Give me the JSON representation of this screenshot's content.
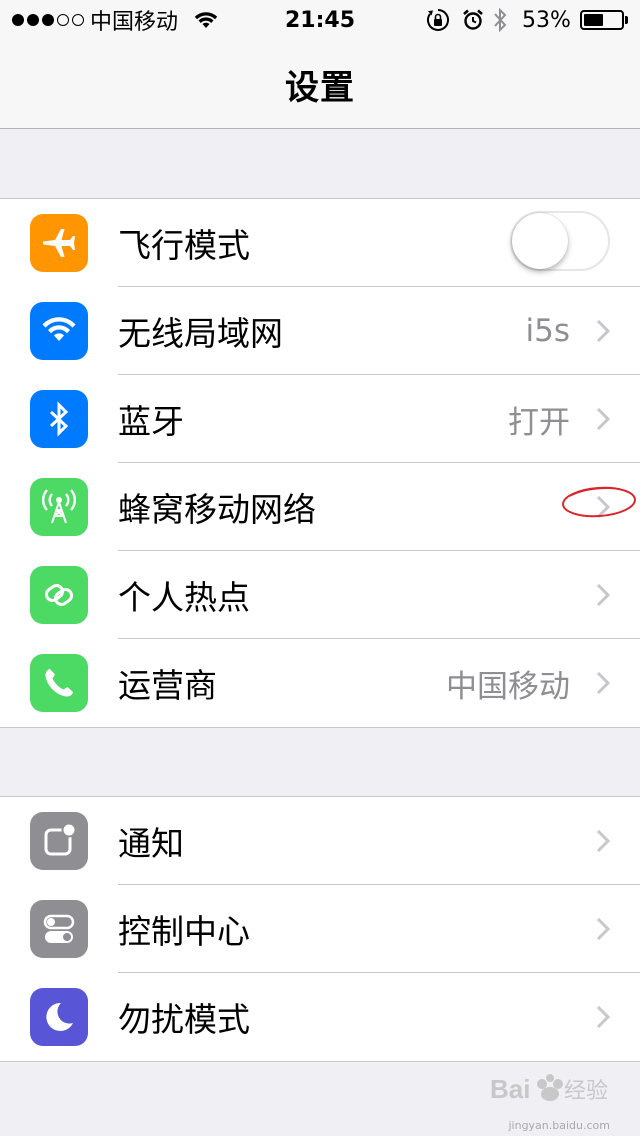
{
  "status_bar": {
    "carrier": "中国移动",
    "time": "21:45",
    "battery_percent": "53%",
    "battery_level": 0.53
  },
  "nav": {
    "title": "设置"
  },
  "group1": [
    {
      "label": "飞行模式",
      "icon": "airplane-icon",
      "color": "#ff9500",
      "toggle": false
    },
    {
      "label": "无线局域网",
      "icon": "wifi-icon",
      "color": "#007aff",
      "value": "i5s"
    },
    {
      "label": "蓝牙",
      "icon": "bluetooth-icon",
      "color": "#007aff",
      "value": "打开"
    },
    {
      "label": "蜂窝移动网络",
      "icon": "cellular-antenna-icon",
      "color": "#4cd964",
      "value": ""
    },
    {
      "label": "个人热点",
      "icon": "hotspot-link-icon",
      "color": "#4cd964",
      "value": ""
    },
    {
      "label": "运营商",
      "icon": "phone-icon",
      "color": "#4cd964",
      "value": "中国移动"
    }
  ],
  "group2": [
    {
      "label": "通知",
      "icon": "notifications-icon",
      "color": "#8e8e93"
    },
    {
      "label": "控制中心",
      "icon": "control-center-icon",
      "color": "#8e8e93"
    },
    {
      "label": "勿扰模式",
      "icon": "moon-icon",
      "color": "#5856d6"
    }
  ],
  "watermark": {
    "text": "Bai经验",
    "sub": "jingyan.baidu.com"
  }
}
